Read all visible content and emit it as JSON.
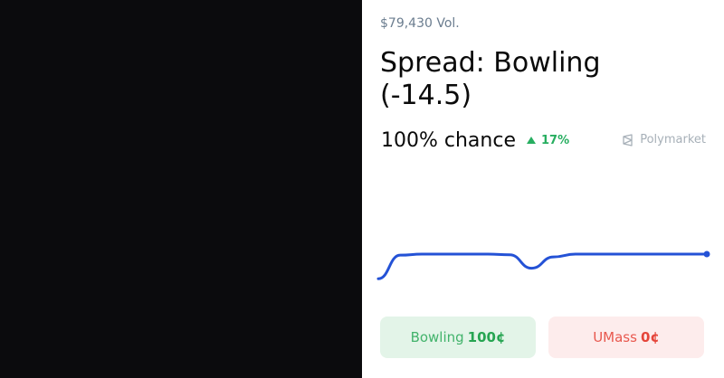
{
  "market": {
    "volume": "$79,430 Vol.",
    "title": "Spread: Bowling (-14.5)",
    "chance": "100% chance",
    "change": "17%",
    "brand": "Polymarket"
  },
  "buttons": {
    "yes": {
      "label": "Bowling",
      "price": "100¢"
    },
    "no": {
      "label": "UMass",
      "price": "0¢"
    }
  },
  "chart_data": {
    "type": "line",
    "series": [
      {
        "values": [
          30,
          97,
          100,
          100,
          100,
          100,
          98,
          60,
          92,
          100,
          100,
          100,
          100,
          100,
          100,
          100
        ]
      }
    ],
    "ylim": [
      0,
      100
    ],
    "grid": false,
    "line_color": "#2452d6"
  },
  "colors": {
    "accent_line": "#2452d6",
    "up": "#27ae60",
    "yes_bg": "#e3f4e8",
    "no_bg": "#fdecec"
  }
}
